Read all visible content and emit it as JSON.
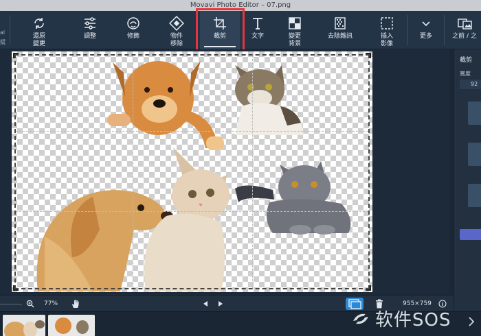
{
  "window": {
    "title": "Movavi Photo Editor – 07.png"
  },
  "toolbar": {
    "left_fragment_top": "al",
    "left_fragment_bottom": "斌",
    "items": [
      {
        "label": "還原\n變更",
        "icon": "redo-icon"
      },
      {
        "label": "調整",
        "icon": "sliders-icon"
      },
      {
        "label": "修飾",
        "icon": "retouch-icon"
      },
      {
        "label": "物件\n移除",
        "icon": "object-removal-icon"
      },
      {
        "label": "裁剪",
        "icon": "crop-icon"
      },
      {
        "label": "文字",
        "icon": "text-icon"
      },
      {
        "label": "變更\n背景",
        "icon": "change-background-icon"
      },
      {
        "label": "去除雜訊",
        "icon": "denoise-icon"
      },
      {
        "label": "插入\n影像",
        "icon": "insert-image-icon"
      },
      {
        "label": "更多",
        "icon": "chevron-down-icon"
      },
      {
        "label": "之前 / 之",
        "icon": "before-after-icon"
      }
    ],
    "active_item": "裁剪",
    "highlight_color": "#e8343a"
  },
  "right_panel": {
    "title": "裁剪",
    "width_label": "寬度",
    "width_value": "92",
    "accent_color": "#5b66c9"
  },
  "bottombar": {
    "zoom": "77%",
    "image_size": "955×759",
    "layer_color": "#2a8ad9"
  },
  "watermark": {
    "text": "软件SOS"
  }
}
